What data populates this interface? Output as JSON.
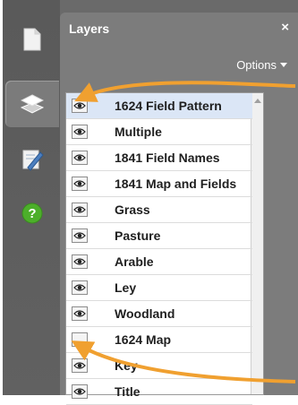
{
  "panel": {
    "title": "Layers",
    "close_glyph": "×",
    "options_label": "Options"
  },
  "tabs": [
    {
      "icon": "document-icon",
      "active": false
    },
    {
      "icon": "layers-icon",
      "active": true
    },
    {
      "icon": "pen-edit-icon",
      "active": false
    },
    {
      "icon": "help-icon",
      "glyph": "?",
      "active": false
    }
  ],
  "layers": [
    {
      "label": "1624 Field Pattern",
      "visible": true,
      "selected": true
    },
    {
      "label": "Multiple",
      "visible": true,
      "selected": false
    },
    {
      "label": "1841 Field Names",
      "visible": true,
      "selected": false
    },
    {
      "label": "1841 Map and Fields",
      "visible": true,
      "selected": false
    },
    {
      "label": "Grass",
      "visible": true,
      "selected": false
    },
    {
      "label": "Pasture",
      "visible": true,
      "selected": false
    },
    {
      "label": "Arable",
      "visible": true,
      "selected": false
    },
    {
      "label": "Ley",
      "visible": true,
      "selected": false
    },
    {
      "label": "Woodland",
      "visible": true,
      "selected": false
    },
    {
      "label": "1624 Map",
      "visible": false,
      "selected": false
    },
    {
      "label": "Key",
      "visible": true,
      "selected": false
    },
    {
      "label": "Title",
      "visible": true,
      "selected": false
    }
  ],
  "colors": {
    "accent_arrow": "#f0a030",
    "help_green": "#4caf2a",
    "selected_row": "#dbe6f6"
  }
}
